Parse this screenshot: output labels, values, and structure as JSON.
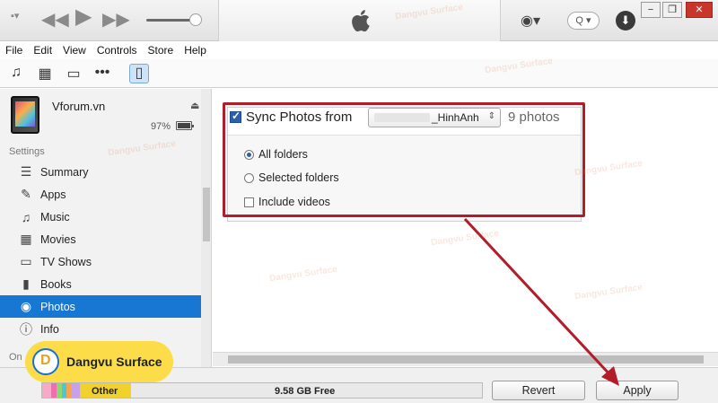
{
  "menu": [
    "File",
    "Edit",
    "View",
    "Controls",
    "Store",
    "Help"
  ],
  "search_glyph": "Q",
  "device": {
    "name": "Vforum.vn",
    "battery": "97%",
    "battery_level": 0.97
  },
  "sidebar": {
    "settings_header": "Settings",
    "items": [
      {
        "label": "Summary",
        "icon": "summary-icon",
        "glyph": "☰"
      },
      {
        "label": "Apps",
        "icon": "apps-icon",
        "glyph": "✎"
      },
      {
        "label": "Music",
        "icon": "music-icon",
        "glyph": "♫"
      },
      {
        "label": "Movies",
        "icon": "movies-icon",
        "glyph": "▦"
      },
      {
        "label": "TV Shows",
        "icon": "tv-icon",
        "glyph": "▭"
      },
      {
        "label": "Books",
        "icon": "books-icon",
        "glyph": "▮"
      },
      {
        "label": "Photos",
        "icon": "camera-icon",
        "glyph": "◉",
        "active": true
      },
      {
        "label": "Info",
        "icon": "info-icon",
        "glyph": "ⓘ"
      }
    ],
    "on_device_label": "On"
  },
  "sync": {
    "label": "Sync Photos from",
    "checked": true,
    "folder_value": "_HinhAnh",
    "photo_count": "9 photos",
    "options": {
      "all_folders": "All folders",
      "selected_folders": "Selected folders",
      "include_videos": "Include videos"
    }
  },
  "capacity": {
    "other_label": "Other",
    "free_label": "9.58 GB Free",
    "segments": [
      {
        "color": "#f7a9c8",
        "fraction": 0.02
      },
      {
        "color": "#f36bb1",
        "fraction": 0.012
      },
      {
        "color": "#8ed66f",
        "fraction": 0.012
      },
      {
        "color": "#4dc4d9",
        "fraction": 0.012
      },
      {
        "color": "#f7a54a",
        "fraction": 0.01
      },
      {
        "color": "#c7a2e8",
        "fraction": 0.02
      },
      {
        "color": "#f1d22c",
        "fraction": 0.116
      }
    ]
  },
  "buttons": {
    "revert": "Revert",
    "apply": "Apply"
  },
  "brand": {
    "badge_text": "Dangvu Surface",
    "watermark": "Dangvu Surface"
  },
  "colors": {
    "accent": "#1877d2",
    "highlight_box": "#b31d2a",
    "badge": "#fddc4a"
  }
}
